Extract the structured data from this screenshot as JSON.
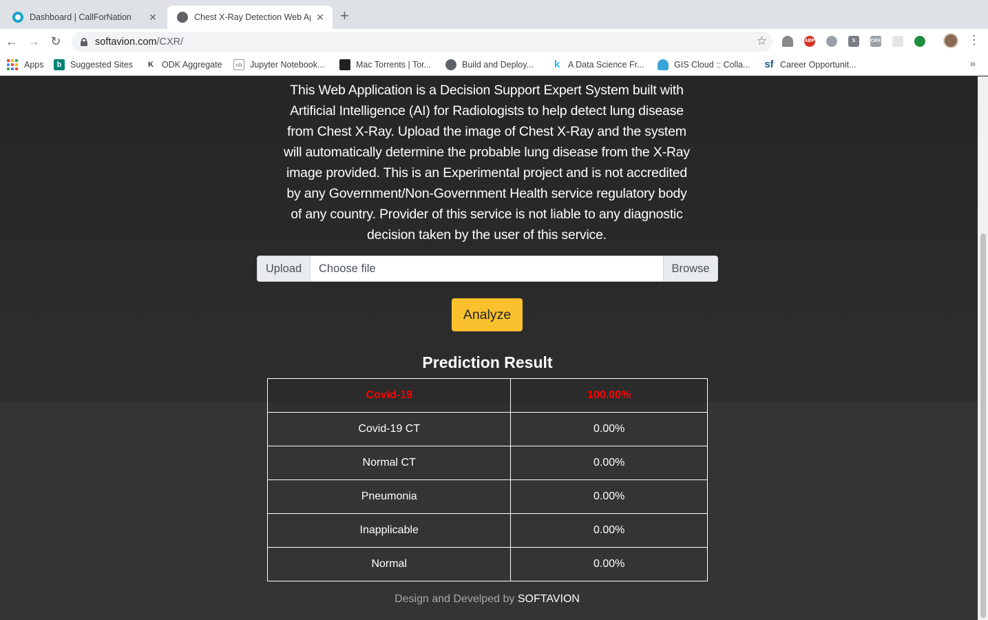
{
  "browser": {
    "tabs": [
      {
        "title": "Dashboard | CallForNation",
        "active": false,
        "favicon_color": "#1da1c8"
      },
      {
        "title": "Chest X-Ray Detection Web Ap",
        "active": true,
        "favicon_color": "#5f6368"
      }
    ],
    "url_host": "softavion.com",
    "url_path": "/CXR/",
    "bookmarks": [
      {
        "label": "Apps",
        "icon": "apps-grid-icon"
      },
      {
        "label": "Suggested Sites",
        "icon": "bing-icon"
      },
      {
        "label": "ODK Aggregate",
        "icon": "odk-icon"
      },
      {
        "label": "Jupyter Notebook...",
        "icon": "jupyter-icon"
      },
      {
        "label": "Mac Torrents | Tor...",
        "icon": "torrent-icon"
      },
      {
        "label": "Build and Deploy...",
        "icon": "globe-icon"
      },
      {
        "label": "A Data Science Fr...",
        "icon": "kaggle-icon"
      },
      {
        "label": "GIS Cloud :: Colla...",
        "icon": "cloud-icon"
      },
      {
        "label": "Career Opportunit...",
        "icon": "sf-icon"
      }
    ]
  },
  "page": {
    "intro": "This Web Application is a Decision Support Expert System built with Artificial Intelligence (AI) for Radiologists to help detect lung disease from Chest X-Ray. Upload the image of Chest X-Ray and the system will automatically determine the probable lung disease from the X-Ray image provided. This is an Experimental project and is not accredited by any Government/Non-Government Health service regulatory body of any country. Provider of this service is not liable to any diagnostic decision taken by the user of this service.",
    "upload_label": "Upload",
    "file_placeholder": "Choose file",
    "browse_label": "Browse",
    "analyze_label": "Analyze",
    "result_title": "Prediction Result",
    "results": [
      {
        "label": "Covid-19",
        "value": "100.00%"
      },
      {
        "label": "Covid-19 CT",
        "value": "0.00%"
      },
      {
        "label": "Normal CT",
        "value": "0.00%"
      },
      {
        "label": "Pneumonia",
        "value": "0.00%"
      },
      {
        "label": "Inapplicable",
        "value": "0.00%"
      },
      {
        "label": "Normal",
        "value": "0.00%"
      }
    ],
    "footer_text": "Design and Develped by",
    "footer_brand": "SOFTAVION"
  },
  "colors": {
    "accent": "#fbc02d",
    "highlight": "#ff0000",
    "background": "#343434"
  }
}
